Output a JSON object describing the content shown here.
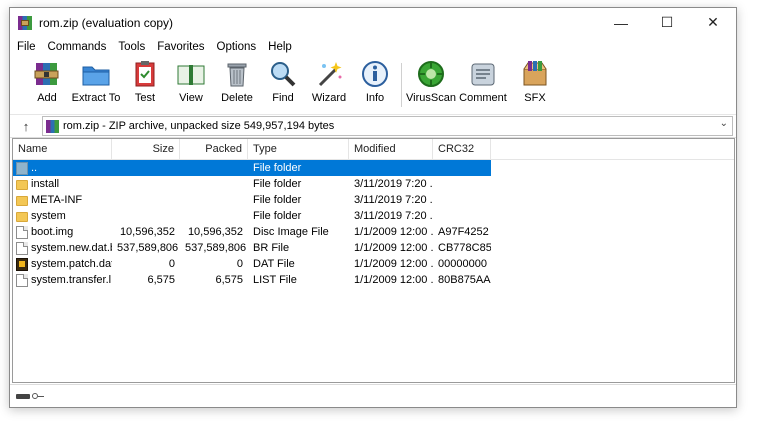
{
  "window": {
    "title": "rom.zip (evaluation copy)",
    "minimize": "—",
    "maximize": "☐",
    "close": "✕"
  },
  "menu": [
    "File",
    "Commands",
    "Tools",
    "Favorites",
    "Options",
    "Help"
  ],
  "toolbar": [
    {
      "label": "Add",
      "icon": "add-archive-icon"
    },
    {
      "label": "Extract To",
      "icon": "extract-folder-icon"
    },
    {
      "label": "Test",
      "icon": "test-clipboard-icon"
    },
    {
      "label": "View",
      "icon": "view-book-icon"
    },
    {
      "label": "Delete",
      "icon": "trash-icon"
    },
    {
      "label": "Find",
      "icon": "magnifier-icon"
    },
    {
      "label": "Wizard",
      "icon": "wand-icon"
    },
    {
      "label": "Info",
      "icon": "info-icon"
    },
    {
      "label": "VirusScan",
      "icon": "virus-scan-icon"
    },
    {
      "label": "Comment",
      "icon": "comment-icon"
    },
    {
      "label": "SFX",
      "icon": "sfx-box-icon"
    }
  ],
  "address": {
    "up": "↑",
    "text": "rom.zip - ZIP archive, unpacked size 549,957,194 bytes",
    "dropdown": "⌄"
  },
  "columns": {
    "name": "Name",
    "size": "Size",
    "packed": "Packed",
    "type": "Type",
    "modified": "Modified",
    "crc": "CRC32",
    "sort_caret": "^"
  },
  "files": [
    {
      "name": "..",
      "size": "",
      "packed": "",
      "type": "File folder",
      "modified": "",
      "crc": "",
      "icon": "up"
    },
    {
      "name": "install",
      "size": "",
      "packed": "",
      "type": "File folder",
      "modified": "3/11/2019 7:20 ...",
      "crc": "",
      "icon": "folder"
    },
    {
      "name": "META-INF",
      "size": "",
      "packed": "",
      "type": "File folder",
      "modified": "3/11/2019 7:20 ...",
      "crc": "",
      "icon": "folder"
    },
    {
      "name": "system",
      "size": "",
      "packed": "",
      "type": "File folder",
      "modified": "3/11/2019 7:20 ...",
      "crc": "",
      "icon": "folder"
    },
    {
      "name": "boot.img",
      "size": "10,596,352",
      "packed": "10,596,352",
      "type": "Disc Image File",
      "modified": "1/1/2009 12:00 ...",
      "crc": "A97F4252",
      "icon": "file"
    },
    {
      "name": "system.new.dat.br",
      "size": "537,589,806",
      "packed": "537,589,806",
      "type": "BR File",
      "modified": "1/1/2009 12:00 ...",
      "crc": "CB778C85",
      "icon": "file"
    },
    {
      "name": "system.patch.dat",
      "size": "0",
      "packed": "0",
      "type": "DAT File",
      "modified": "1/1/2009 12:00 ...",
      "crc": "00000000",
      "icon": "dat"
    },
    {
      "name": "system.transfer.l...",
      "size": "6,575",
      "packed": "6,575",
      "type": "LIST File",
      "modified": "1/1/2009 12:00 ...",
      "crc": "80B875AA",
      "icon": "file"
    }
  ],
  "colors": {
    "selection": "#0078d7",
    "folder": "#f3c755"
  }
}
